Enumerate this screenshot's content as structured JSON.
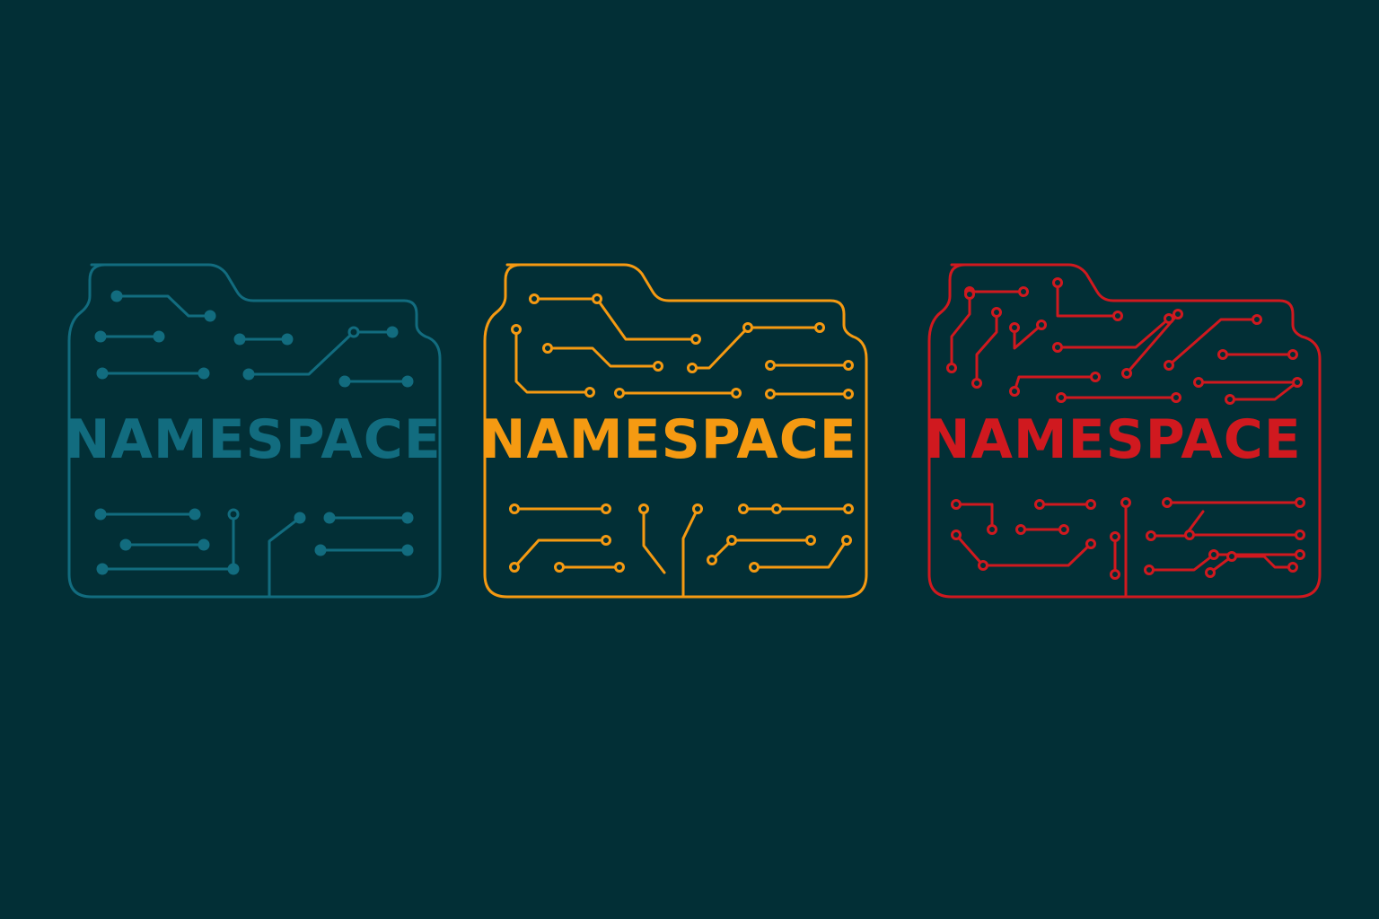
{
  "canvas": {
    "background": "#022f36"
  },
  "logos": [
    {
      "text": "NAMESPACE",
      "color": "#126c7f",
      "icon": "circuit-folder-icon"
    },
    {
      "text": "NAMESPACE",
      "color": "#f59a12",
      "icon": "circuit-folder-icon"
    },
    {
      "text": "NAMESPACE",
      "color": "#d0191f",
      "icon": "circuit-folder-icon"
    }
  ]
}
